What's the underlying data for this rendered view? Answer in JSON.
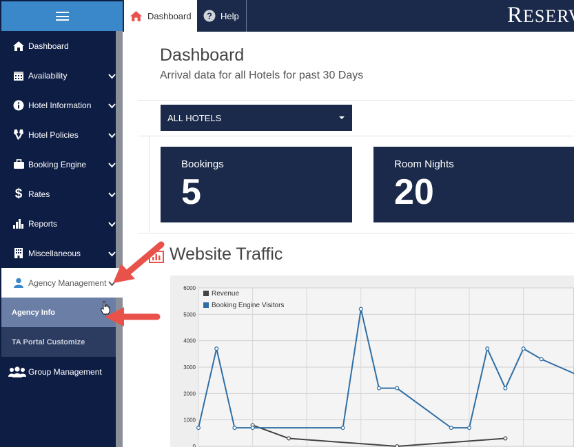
{
  "sidebar": {
    "menu_icon": "hamburger-icon",
    "items": [
      {
        "label": "Dashboard",
        "icon": "home-icon"
      },
      {
        "label": "Availability",
        "icon": "calendar-icon"
      },
      {
        "label": "Hotel Information",
        "icon": "info-icon"
      },
      {
        "label": "Hotel Policies",
        "icon": "tools-icon"
      },
      {
        "label": "Booking Engine",
        "icon": "briefcase-icon"
      },
      {
        "label": "Rates",
        "icon": "dollar-icon"
      },
      {
        "label": "Reports",
        "icon": "bar-chart-icon"
      },
      {
        "label": "Miscellaneous",
        "icon": "building-icon"
      },
      {
        "label": "Agency Management",
        "icon": "user-icon"
      }
    ],
    "subitems": [
      {
        "label": "Agency Info"
      },
      {
        "label": "TA Portal Customize"
      }
    ],
    "group_item": {
      "label": "Group Management",
      "icon": "group-icon"
    }
  },
  "header": {
    "tabs": [
      {
        "label": "Dashboard",
        "icon": "home-icon"
      },
      {
        "label": "Help",
        "icon": "question-icon"
      }
    ],
    "brand_first": "R",
    "brand_rest": "ESERV"
  },
  "main": {
    "title": "Dashboard",
    "subtitle": "Arrival data for all Hotels for past 30 Days",
    "hotel_select": "ALL HOTELS",
    "stats": [
      {
        "label": "Bookings",
        "value": "5"
      },
      {
        "label": "Room Nights",
        "value": "20"
      }
    ],
    "traffic_title": "Website Traffic"
  },
  "colors": {
    "sidebar_bg": "#0e1d44",
    "accent_blue": "#3a87c9",
    "navy": "#1b2a4a",
    "annotation_red": "#e8524a",
    "series_revenue": "#444444",
    "series_visitors": "#2f6ea5"
  },
  "chart_data": {
    "type": "line",
    "ylim": [
      0,
      6000
    ],
    "yticks": [
      "0",
      "1000",
      "2000",
      "3000",
      "4000",
      "5000",
      "6000"
    ],
    "series": [
      {
        "name": "Revenue",
        "x": [
          3,
          5,
          11,
          17
        ],
        "values": [
          800,
          300,
          0,
          300
        ]
      },
      {
        "name": "Booking Engine Visitors",
        "x": [
          0,
          1,
          2,
          3,
          8,
          9,
          10,
          11,
          14,
          15,
          16,
          17,
          18,
          19,
          21
        ],
        "values": [
          700,
          3700,
          700,
          700,
          700,
          5200,
          2200,
          2200,
          700,
          700,
          3700,
          2200,
          3700,
          3300,
          2700
        ]
      }
    ]
  }
}
